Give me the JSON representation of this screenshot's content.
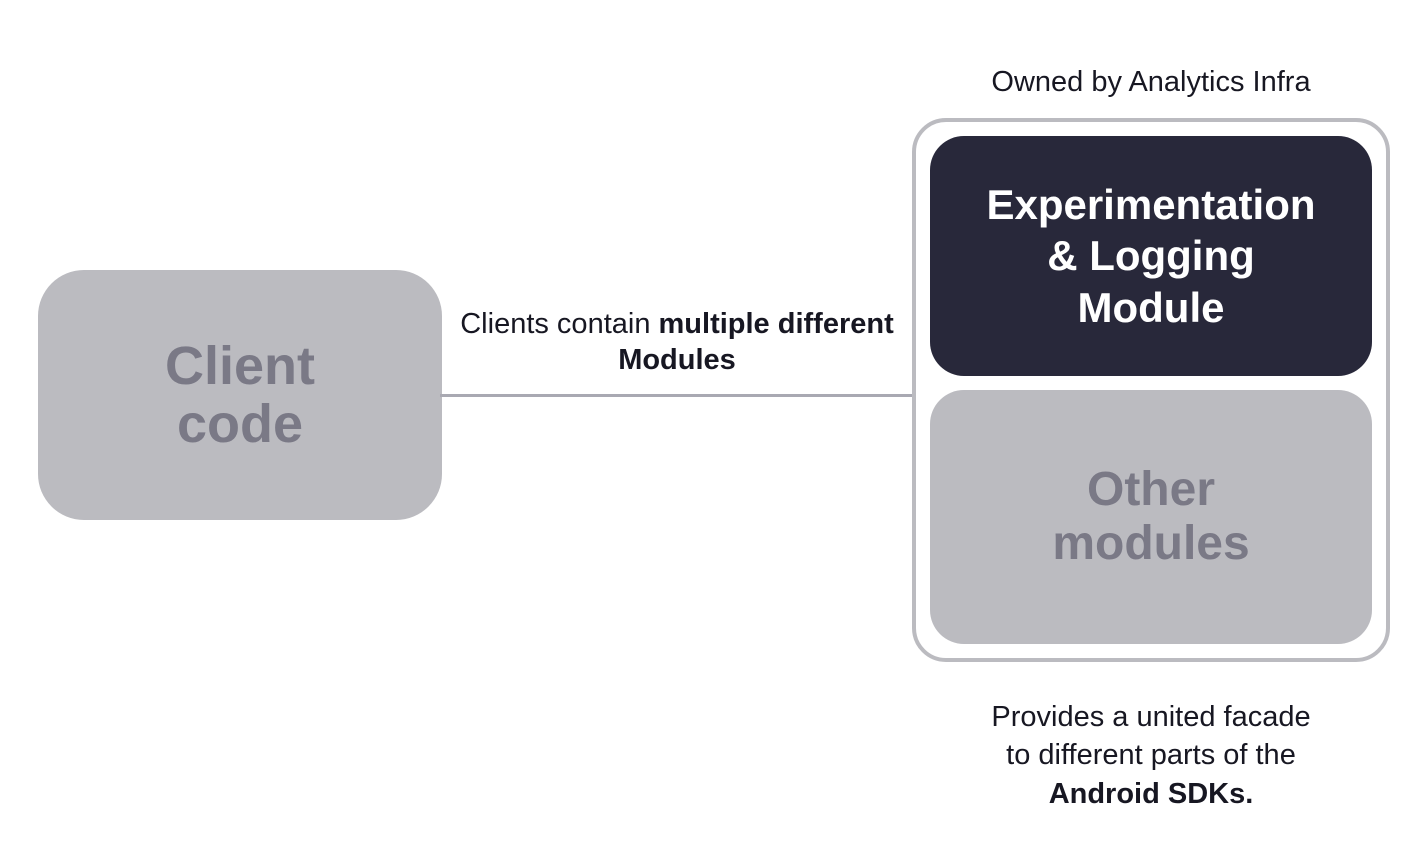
{
  "client_box": {
    "label": "Client\ncode"
  },
  "connector": {
    "label_prefix": "Clients contain ",
    "label_bold": "multiple different  Modules"
  },
  "top_caption": "Owned by Analytics Infra",
  "modules": {
    "experimentation": {
      "label": "Experimentation\n& Logging\nModule"
    },
    "other": {
      "label": "Other\nmodules"
    }
  },
  "bottom_caption": {
    "line_prefix": "Provides a united facade\nto different parts of the\n",
    "line_bold": "Android SDKs."
  }
}
